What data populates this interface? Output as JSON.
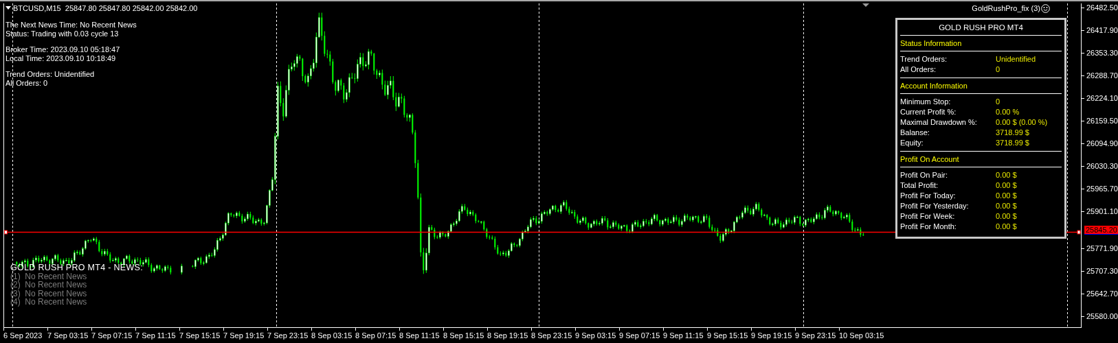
{
  "chart": {
    "symbol_header": "BTCUSD,M15  25847.80 25847.80 25842.00 25842.00",
    "ea_label": "GoldRushPro_fix (3)"
  },
  "info_groups": [
    [
      "The Next News Time: No Recent News",
      "Status: Trading with 0.03 cycle 13"
    ],
    [
      "Broker Time: 2023.09.10 05:18:47",
      "Local Time: 2023.09.10 10:18:49"
    ],
    [
      "Trend Orders: Unidentified",
      "All Orders: 0"
    ]
  ],
  "news": {
    "title": "GOLD RUSH PRO MT4 - NEWS:",
    "items": [
      "(1)  No Recent News",
      "(2)  No Recent News",
      "(3)  No Recent News",
      "(4)  No Recent News"
    ]
  },
  "panel": {
    "title": "GOLD RUSH PRO MT4",
    "sections": [
      {
        "heading": "Status Information",
        "rows": [
          {
            "label": "Trend Orders:",
            "value": "Unidentified"
          },
          {
            "label": "All Orders:",
            "value": "0"
          }
        ]
      },
      {
        "heading": "Account Information",
        "rows": [
          {
            "label": "Minimum Stop:",
            "value": "0"
          },
          {
            "label": "Current Profit %:",
            "value": "0.00 %"
          },
          {
            "label": "Maximal Drawdown %:",
            "value": "0.00 $ (0.00 %)"
          },
          {
            "label": "Balanse:",
            "value": "3718.99 $"
          },
          {
            "label": "Equity:",
            "value": "3718.99 $"
          }
        ]
      },
      {
        "heading": "Profit On Account",
        "rows": [
          {
            "label": "Profit On Pair:",
            "value": "0.00 $"
          },
          {
            "label": "Total Profit:",
            "value": "0.00 $"
          },
          {
            "label": "Profit For Today:",
            "value": "0.00 $"
          },
          {
            "label": "Profit For Yesterday:",
            "value": "0.00 $"
          },
          {
            "label": "Profit For Week:",
            "value": "0.00 $"
          },
          {
            "label": "Profit For Month:",
            "value": "0.00 $"
          }
        ]
      }
    ]
  },
  "price_axis": {
    "labels": [
      "26482.50",
      "26417.90",
      "26353.30",
      "26288.70",
      "26224.10",
      "26159.50",
      "26094.90",
      "26030.30",
      "25965.70",
      "25901.10",
      "25771.90",
      "25707.30",
      "25642.70",
      "25580.00"
    ],
    "current_price": "25845.20"
  },
  "time_axis": {
    "labels": [
      "6 Sep 2023",
      "7 Sep 03:15",
      "7 Sep 07:15",
      "7 Sep 11:15",
      "7 Sep 15:15",
      "7 Sep 19:15",
      "7 Sep 23:15",
      "8 Sep 03:15",
      "8 Sep 07:15",
      "8 Sep 11:15",
      "8 Sep 15:15",
      "8 Sep 19:15",
      "8 Sep 23:15",
      "9 Sep 03:15",
      "9 Sep 07:15",
      "9 Sep 11:15",
      "9 Sep 15:15",
      "9 Sep 19:15",
      "9 Sep 23:15",
      "10 Sep 03:15"
    ]
  }
}
